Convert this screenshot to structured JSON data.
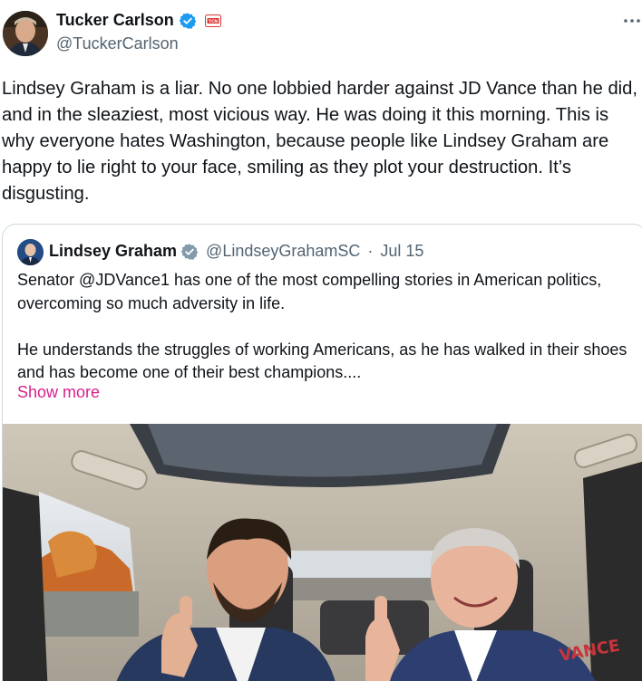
{
  "author": {
    "display_name": "Tucker Carlson",
    "handle": "@TuckerCarlson",
    "affiliate_badge": "TCN"
  },
  "tweet": {
    "text": "Lindsey Graham is a liar. No one lobbied harder against JD Vance than he did, and in the sleaziest, most vicious way. He was doing it this morning. This is why everyone hates Washington, because people like Lindsey Graham are happy to lie right to your face, smiling as they plot your destruction. It’s disgusting."
  },
  "quote": {
    "display_name": "Lindsey Graham",
    "handle": "@LindseyGrahamSC",
    "separator": "·",
    "date": "Jul 15",
    "text": "Senator @JDVance1 has one of the most compelling stories in American politics, overcoming so much adversity in life.\n\nHe understands the struggles of working Americans, as he has walked in their shoes and has become one of their best champions....",
    "show_more": "Show more",
    "photo_text": "VANCE"
  },
  "colors": {
    "verified": "#1d9bf0",
    "show_more": "#d6228a",
    "secondary_text": "#536471",
    "border": "#cfd9de"
  }
}
